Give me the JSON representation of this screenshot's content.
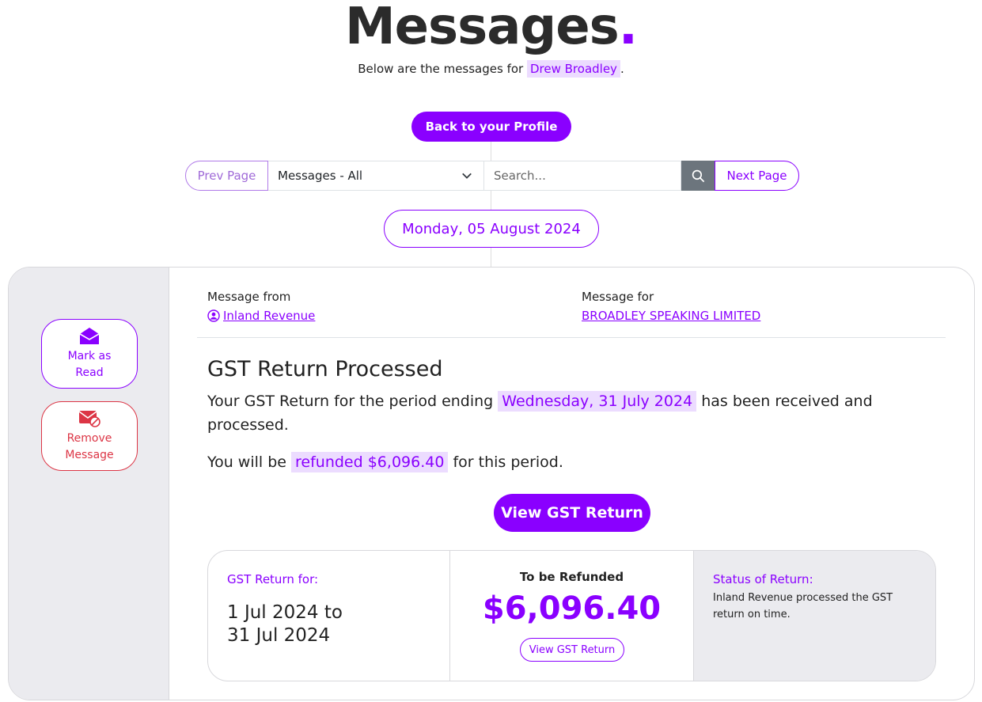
{
  "header": {
    "title": "Messages",
    "title_dot": ".",
    "subtitle_prefix": "Below are the messages for",
    "user_name": "Drew Broadley",
    "subtitle_suffix": "."
  },
  "actions": {
    "back_label": "Back to your Profile"
  },
  "toolbar": {
    "prev_label": "Prev Page",
    "filter_value": "Messages - All",
    "search_placeholder": "Search...",
    "next_label": "Next Page"
  },
  "date_group": "Monday, 05 August 2024",
  "side_actions": {
    "mark_read_line1": "Mark as",
    "mark_read_line2": "Read",
    "remove_line1": "Remove",
    "remove_line2": "Message"
  },
  "message": {
    "from_label": "Message from",
    "from_name": "Inland Revenue",
    "for_label": "Message for",
    "for_name": "BROADLEY SPEAKING LIMITED",
    "title": "GST Return Processed",
    "body_prefix": "Your GST Return for the period ending",
    "period_end": "Wednesday, 31 July 2024",
    "body_suffix": "has been received and processed.",
    "refund_prefix": "You will be",
    "refund_highlight": "refunded $6,096.40",
    "refund_suffix": "for this period.",
    "view_button": "View GST Return"
  },
  "summary": {
    "return_for_label": "GST Return for:",
    "range_line1": "1 Jul 2024 to",
    "range_line2": "31 Jul 2024",
    "refund_label": "To be Refunded",
    "refund_amount": "$6,096.40",
    "refund_button": "View GST Return",
    "status_label": "Status of Return:",
    "status_text": "Inland Revenue processed the GST return on time."
  },
  "colors": {
    "accent": "#8a00ff",
    "danger": "#dc3545",
    "highlight_bg": "#ecdcff",
    "panel_bg": "#ebebef"
  }
}
